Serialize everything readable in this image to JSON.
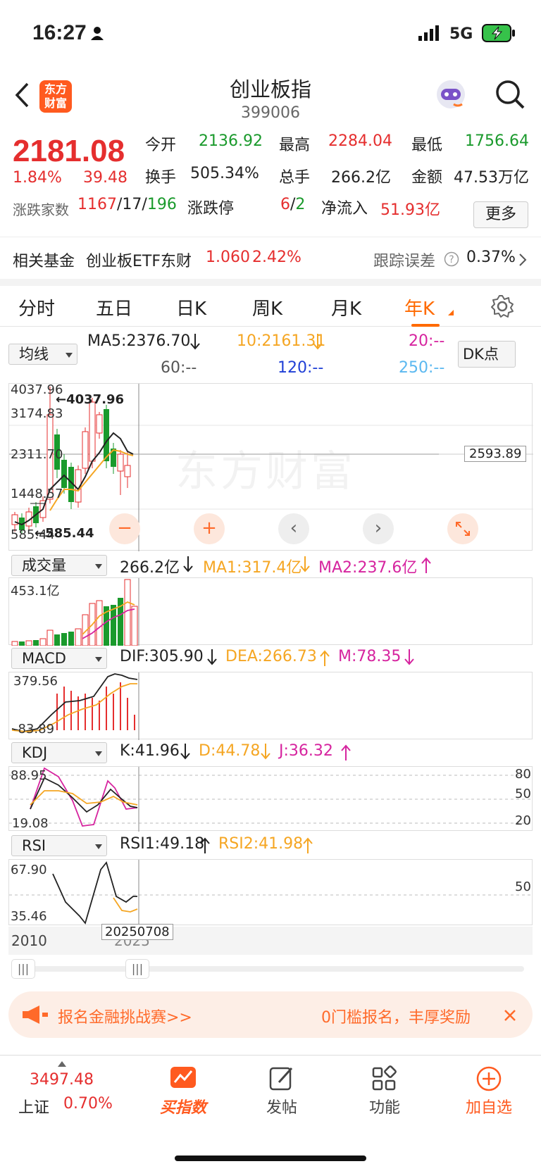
{
  "status_bar": {
    "time": "16:27",
    "network": "5G"
  },
  "nav": {
    "logo_line1": "东方",
    "logo_line2": "财富",
    "title": "创业板指",
    "code": "399006"
  },
  "quote": {
    "price": "2181.08",
    "change_pct": "1.84%",
    "change": "39.48",
    "open_label": "今开",
    "open": "2136.92",
    "high_label": "最高",
    "high": "2284.04",
    "low_label": "最低",
    "low": "1756.64",
    "turnover_label": "换手",
    "turnover": "505.34%",
    "volume_label": "总手",
    "volume": "266.2亿",
    "amount_label": "金额",
    "amount": "47.53万亿",
    "breadth_label": "涨跌家数",
    "up": "1167",
    "flat": "17",
    "down": "196",
    "limit_label": "涨跌停",
    "limit_up": "6",
    "limit_down": "2",
    "inflow_label": "净流入",
    "inflow": "51.93亿",
    "more": "更多"
  },
  "fund": {
    "label": "相关基金",
    "name": "创业板ETF东财",
    "price": "1.060",
    "pct": "2.42%",
    "err_label": "跟踪误差",
    "err": "0.37%"
  },
  "tabs": [
    "分时",
    "五日",
    "日K",
    "周K",
    "月K",
    "年K"
  ],
  "active_tab": 5,
  "main_chart": {
    "indicator_select": "均线",
    "ma5": "MA5:2376.70",
    "ma10": "10:2161.31",
    "ma20": "20:--",
    "ma60": "60:--",
    "ma120": "120:--",
    "ma250": "250:--",
    "dk_btn": "DK点",
    "y_labels": [
      "4037.96",
      "3174.83",
      "2311.70",
      "1448.57",
      "585.44"
    ],
    "max_mark": "4037.96",
    "min_mark": "585.44",
    "cursor_price": "2593.89",
    "watermark": "东方财富"
  },
  "volume": {
    "select": "成交量",
    "value": "266.2亿",
    "ma1": "MA1:317.4亿",
    "ma2": "MA2:237.6亿",
    "y_label": "453.1亿"
  },
  "macd": {
    "select": "MACD",
    "dif": "DIF:305.90",
    "dea": "DEA:266.73",
    "m": "M:78.35",
    "y_top": "379.56",
    "y_bot": "-83.89"
  },
  "kdj": {
    "select": "KDJ",
    "k": "K:41.96",
    "d": "D:44.78",
    "j": "J:36.32",
    "y_top": "88.95",
    "y_bot": "19.08",
    "r80": "80",
    "r50": "50",
    "r20": "20"
  },
  "rsi": {
    "select": "RSI",
    "rsi1": "RSI1:49.18",
    "rsi2": "RSI2:41.98",
    "y_top": "67.90",
    "y_bot": "35.46",
    "r50": "50"
  },
  "x_axis": {
    "start": "2010",
    "cursor_date": "20250708",
    "end": "2025"
  },
  "banner": {
    "text_left": "报名金融挑战赛>>",
    "text_right": "0门槛报名，丰厚奖励"
  },
  "bottom_nav": {
    "index_value": "3497.48",
    "index_name": "上证",
    "index_pct": "0.70%",
    "buy": "买指数",
    "post": "发帖",
    "func": "功能",
    "watch": "加自选"
  },
  "colors": {
    "red": "#e52e2e",
    "green": "#1a9a2c",
    "orange": "#ff6a00",
    "ma10": "#f5a623",
    "ma20": "#d6249f",
    "ma120": "#1f3fd6",
    "ma250": "#5bb8f0"
  }
}
